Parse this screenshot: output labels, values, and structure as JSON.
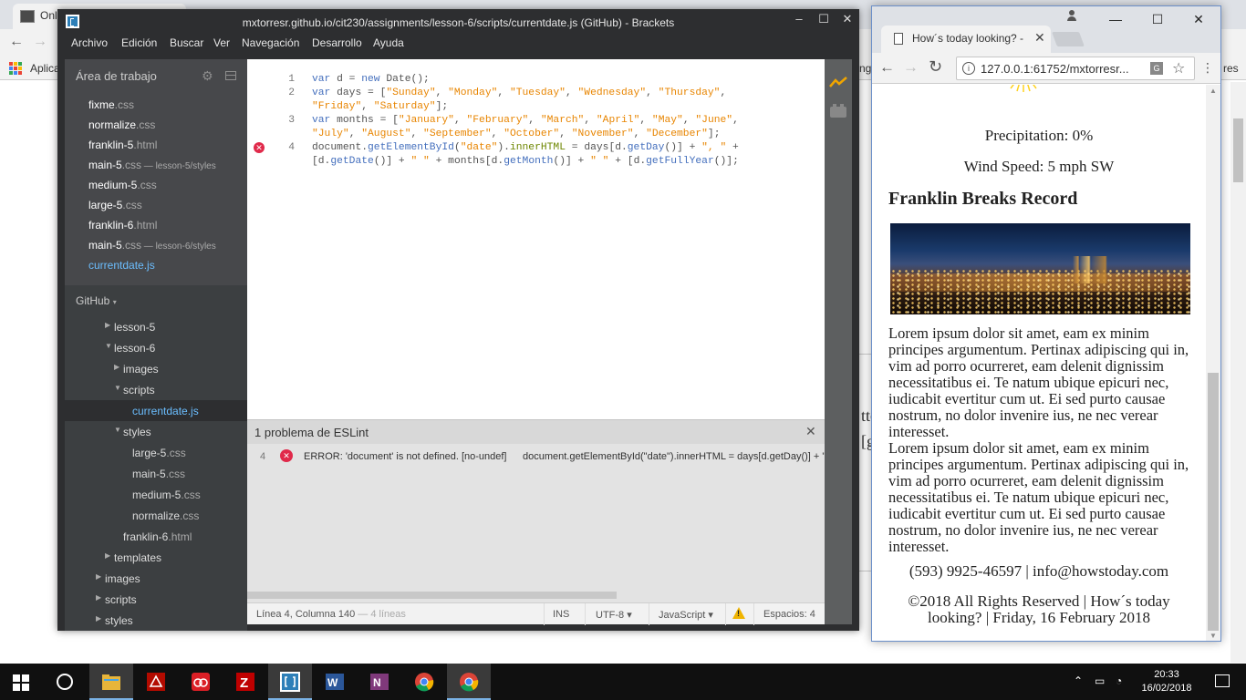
{
  "background_browser": {
    "tab_title": "Onl",
    "apps_label": "Aplica",
    "bookmark_fragment_right_1": "ng",
    "bookmark_fragment_right_2": "res",
    "page_fragment_1": "tte",
    "page_fragment_2": "[g"
  },
  "brackets": {
    "title": "mxtorresr.github.io/cit230/assignments/lesson-6/scripts/currentdate.js (GitHub) - Brackets",
    "menu": [
      "Archivo",
      "Edición",
      "Buscar",
      "Ver",
      "Navegación",
      "Desarrollo",
      "Ayuda"
    ],
    "working_set_title": "Área de trabajo",
    "working_set": [
      {
        "name": "fixme",
        "ext": ".css",
        "sub": ""
      },
      {
        "name": "normalize",
        "ext": ".css",
        "sub": ""
      },
      {
        "name": "franklin-5",
        "ext": ".html",
        "sub": ""
      },
      {
        "name": "main-5",
        "ext": ".css",
        "sub": " — lesson-5/styles"
      },
      {
        "name": "medium-5",
        "ext": ".css",
        "sub": ""
      },
      {
        "name": "large-5",
        "ext": ".css",
        "sub": ""
      },
      {
        "name": "franklin-6",
        "ext": ".html",
        "sub": ""
      },
      {
        "name": "main-5",
        "ext": ".css",
        "sub": " — lesson-6/styles"
      },
      {
        "name": "currentdate",
        "ext": ".js",
        "sub": ""
      }
    ],
    "project_title": "GitHub",
    "tree": [
      {
        "label": "lesson-5",
        "ext": "",
        "type": "folder",
        "expanded": false,
        "depth": 1
      },
      {
        "label": "lesson-6",
        "ext": "",
        "type": "folder",
        "expanded": true,
        "depth": 1
      },
      {
        "label": "images",
        "ext": "",
        "type": "folder",
        "expanded": false,
        "depth": 2
      },
      {
        "label": "scripts",
        "ext": "",
        "type": "folder",
        "expanded": true,
        "depth": 2
      },
      {
        "label": "currentdate",
        "ext": ".js",
        "type": "file",
        "depth": 3,
        "selected": true
      },
      {
        "label": "styles",
        "ext": "",
        "type": "folder",
        "expanded": true,
        "depth": 2
      },
      {
        "label": "large-5",
        "ext": ".css",
        "type": "file",
        "depth": 3
      },
      {
        "label": "main-5",
        "ext": ".css",
        "type": "file",
        "depth": 3
      },
      {
        "label": "medium-5",
        "ext": ".css",
        "type": "file",
        "depth": 3
      },
      {
        "label": "normalize",
        "ext": ".css",
        "type": "file",
        "depth": 3
      },
      {
        "label": "franklin-6",
        "ext": ".html",
        "type": "file",
        "depth": 2
      },
      {
        "label": "templates",
        "ext": "",
        "type": "folder",
        "expanded": false,
        "depth": 1
      },
      {
        "label": "images",
        "ext": "",
        "type": "folder",
        "expanded": false,
        "depth": 0
      },
      {
        "label": "scripts",
        "ext": "",
        "type": "folder",
        "expanded": false,
        "depth": 0
      },
      {
        "label": "styles",
        "ext": "",
        "type": "folder",
        "expanded": false,
        "depth": 0
      }
    ],
    "code_lines": [
      {
        "num": "1",
        "text": "var d = new Date();"
      },
      {
        "num": "2",
        "text": "var days = [\"Sunday\", \"Monday\", \"Tuesday\", \"Wednesday\", \"Thursday\","
      },
      {
        "num": "",
        "text": "\"Friday\", \"Saturday\"];"
      },
      {
        "num": "3",
        "text": "var months = [\"January\", \"February\", \"March\", \"April\", \"May\", \"June\","
      },
      {
        "num": "",
        "text": "\"July\", \"August\", \"September\", \"October\", \"November\", \"December\"];"
      },
      {
        "num": "4",
        "text": "document.getElementById(\"date\").innerHTML = days[d.getDay()] + \", \" +"
      },
      {
        "num": "",
        "text": "[d.getDate()] + \" \" + months[d.getMonth()] + \" \" + [d.getFullYear()];"
      }
    ],
    "problems": {
      "title": "1 problema de ESLint",
      "line": "4",
      "message": "ERROR: 'document' is not defined. [no-undef]",
      "code": "document.getElementById(\"date\").innerHTML = days[d.getDay()] + \", \" +"
    },
    "status": {
      "position": "Línea 4, Columna 140",
      "lines": " — 4 líneas",
      "mode": "INS",
      "encoding": "UTF-8",
      "language": "JavaScript",
      "spaces": "Espacios:  4"
    }
  },
  "chrome": {
    "tab_title": "How´s today looking? -",
    "url": "127.0.0.1:61752/mxtorresr...",
    "page": {
      "precipitation": "Precipitation: 0%",
      "wind": "Wind Speed: 5 mph SW",
      "article_title": "Franklin Breaks Record",
      "lorem_1": "Lorem ipsum dolor sit amet, eam ex minim principes argumentum. Pertinax adipiscing qui in, vim ad porro ocurreret, eam delenit dignissim necessitatibus ei. Te natum ubique epicuri nec, iudicabit evertitur cum ut. Ei sed purto causae nostrum, no dolor invenire ius, ne nec verear interesset.",
      "lorem_2": "Lorem ipsum dolor sit amet, eam ex minim principes argumentum. Pertinax adipiscing qui in, vim ad porro ocurreret, eam delenit dignissim necessitatibus ei. Te natum ubique epicuri nec, iudicabit evertitur cum ut. Ei sed purto causae nostrum, no dolor invenire ius, ne nec verear interesset.",
      "contact": "(593) 9925-46597 | info@howstoday.com",
      "footer": "©2018 All Rights Reserved | How´s today looking? | Friday, 16 February 2018"
    }
  },
  "taskbar": {
    "apps": [
      "file-explorer",
      "acrobat-reader",
      "creative-cloud",
      "filezilla",
      "brackets",
      "word",
      "onenote",
      "chrome",
      "chrome-2"
    ],
    "time": "20:33",
    "date": "16/02/2018"
  },
  "colors": {
    "brackets_dark": "#2d2e30",
    "sidebar": "#47484b",
    "link_blue": "#6bbeff",
    "error_red": "#e0294a",
    "string_orange": "#e88501",
    "keyword_blue": "#446fbd"
  }
}
